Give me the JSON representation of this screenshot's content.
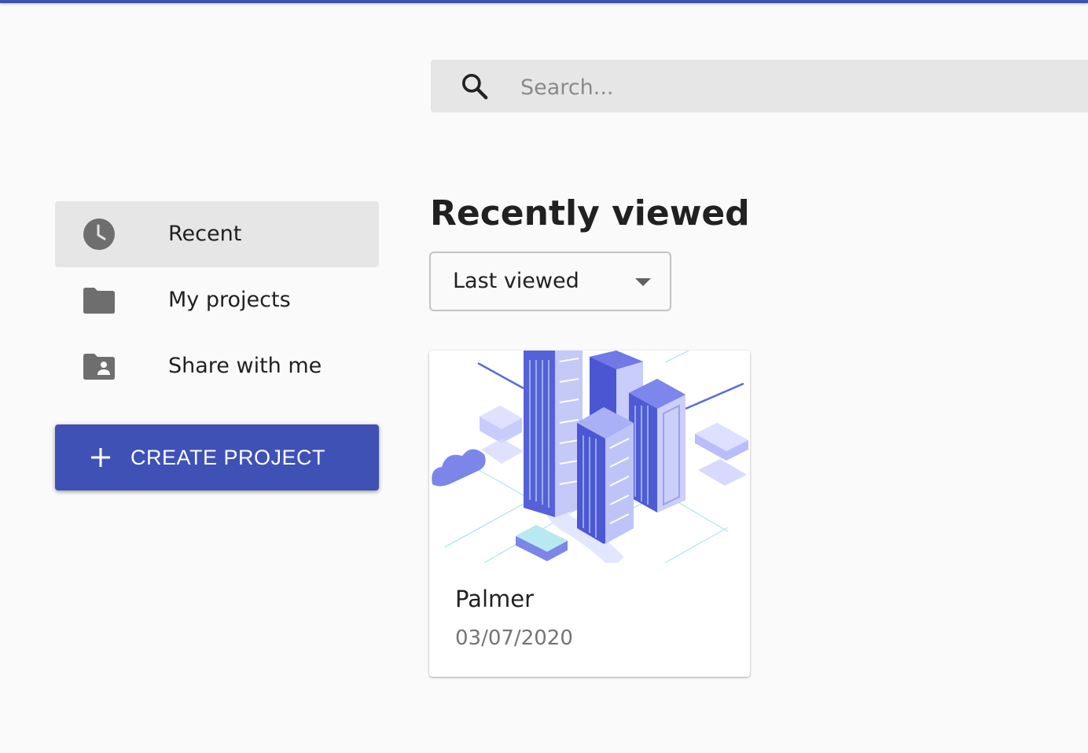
{
  "colors": {
    "accent": "#3f51b5",
    "icon_gray": "#6e6e6e",
    "surface": "#e6e6e6"
  },
  "search": {
    "placeholder": "Search...",
    "icon": "search-icon"
  },
  "sidebar": {
    "items": [
      {
        "label": "Recent",
        "icon": "clock-icon",
        "active": true
      },
      {
        "label": "My projects",
        "icon": "folder-icon",
        "active": false
      },
      {
        "label": "Share with me",
        "icon": "shared-folder-icon",
        "active": false
      }
    ],
    "create_button": {
      "label": "CREATE PROJECT",
      "icon": "plus-icon"
    }
  },
  "main": {
    "title": "Recently viewed",
    "sort": {
      "selected": "Last viewed",
      "icon": "caret-down-icon"
    },
    "projects": [
      {
        "name": "Palmer",
        "date": "03/07/2020"
      }
    ]
  }
}
